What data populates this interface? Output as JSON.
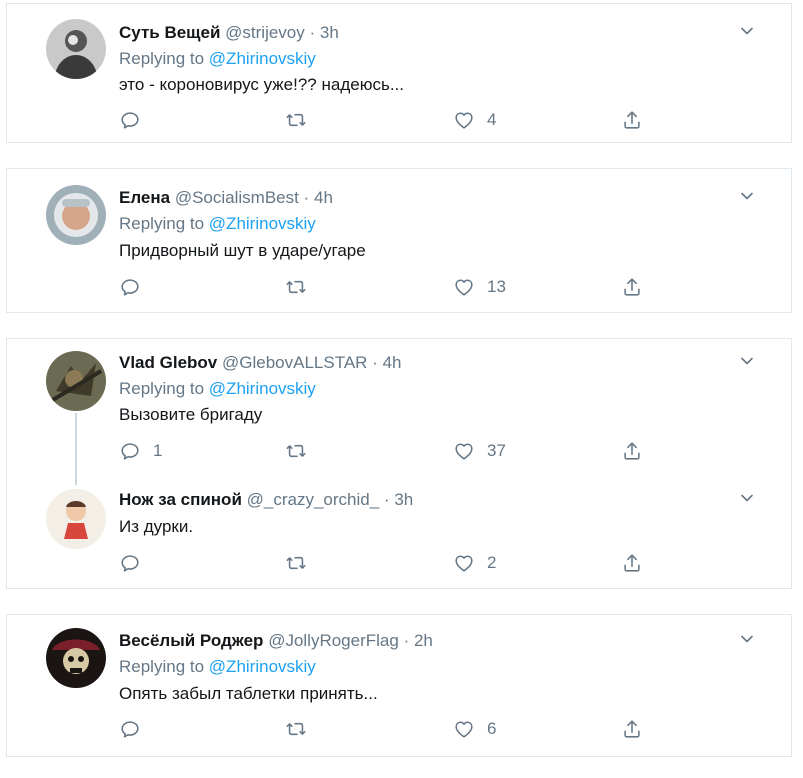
{
  "tweets": [
    {
      "name": "Суть Вещей",
      "handle": "@strijevoy",
      "dot": "·",
      "time": "3h",
      "replying_prefix": "Replying to",
      "replying_to": "@Zhirinovskiy",
      "text": "это - короновирус уже!?? надеюсь...",
      "reply_count": "",
      "retweet_count": "",
      "like_count": "4"
    },
    {
      "name": "Елена",
      "handle": "@SocialismBest",
      "dot": "·",
      "time": "4h",
      "replying_prefix": "Replying to",
      "replying_to": "@Zhirinovskiy",
      "text": "Придворный шут в ударе/угаре",
      "reply_count": "",
      "retweet_count": "",
      "like_count": "13"
    },
    {
      "name": "Vlad Glebov",
      "handle": "@GlebovALLSTAR",
      "dot": "·",
      "time": "4h",
      "replying_prefix": "Replying to",
      "replying_to": "@Zhirinovskiy",
      "text": "Вызовите бригаду",
      "reply_count": "1",
      "retweet_count": "",
      "like_count": "37"
    },
    {
      "name": "Нож за спиной",
      "handle": "@_crazy_orchid_",
      "dot": "·",
      "time": "3h",
      "text": "Из дурки.",
      "reply_count": "",
      "retweet_count": "",
      "like_count": "2"
    },
    {
      "name": "Весёлый Роджер",
      "handle": "@JollyRogerFlag",
      "dot": "·",
      "time": "2h",
      "replying_prefix": "Replying to",
      "replying_to": "@Zhirinovskiy",
      "text": "Опять забыл таблетки принять...",
      "reply_count": "",
      "retweet_count": "",
      "like_count": "6"
    }
  ],
  "icons": {
    "reply": "reply-icon",
    "retweet": "retweet-icon",
    "like": "like-icon",
    "share": "share-icon",
    "more": "chevron-down-icon"
  },
  "colors": {
    "accent": "#1da1f2",
    "secondary_text": "#657786",
    "border": "#e1e8ed"
  }
}
